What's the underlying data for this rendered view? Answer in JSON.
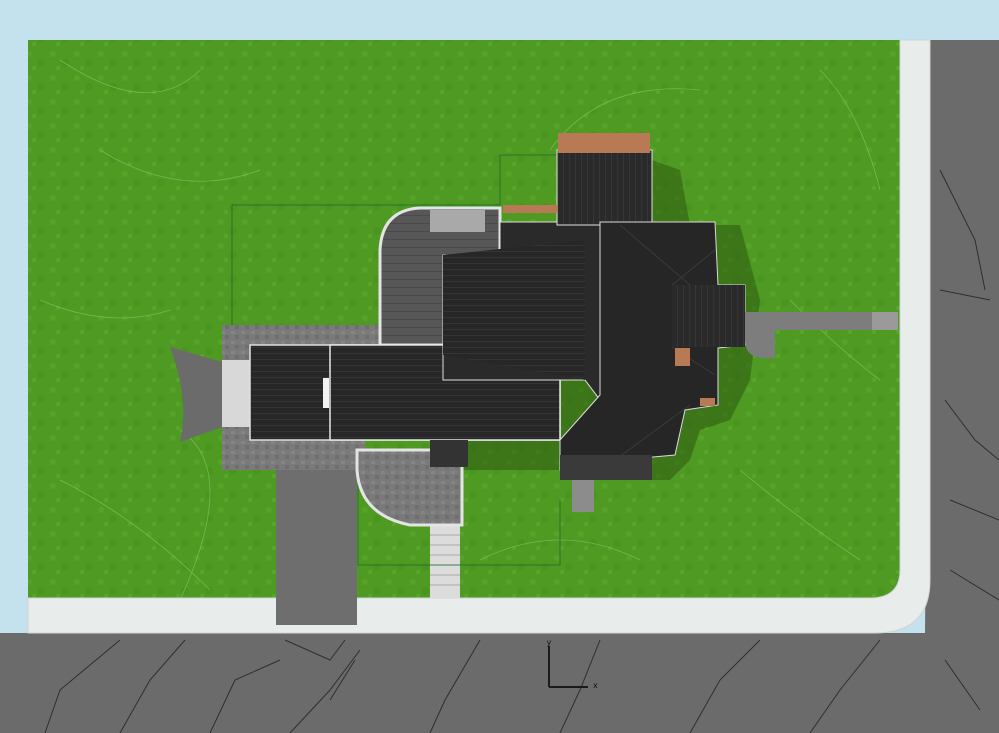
{
  "axis_labels": {
    "y": "y",
    "x": "x"
  },
  "colors": {
    "sky": "#c3e2ee",
    "lawn": "#4f9a22",
    "lawn_light": "#66b532",
    "sidewalk": "#e8ecea",
    "road": "#6b6b6b",
    "road_line": "#2f2f2f",
    "roof": "#272727",
    "roof_dark": "#1b1b1b",
    "paver": "#7b7b7b",
    "deck": "#595959",
    "shadow": "#2e5a13",
    "wood": "#b77a55"
  }
}
